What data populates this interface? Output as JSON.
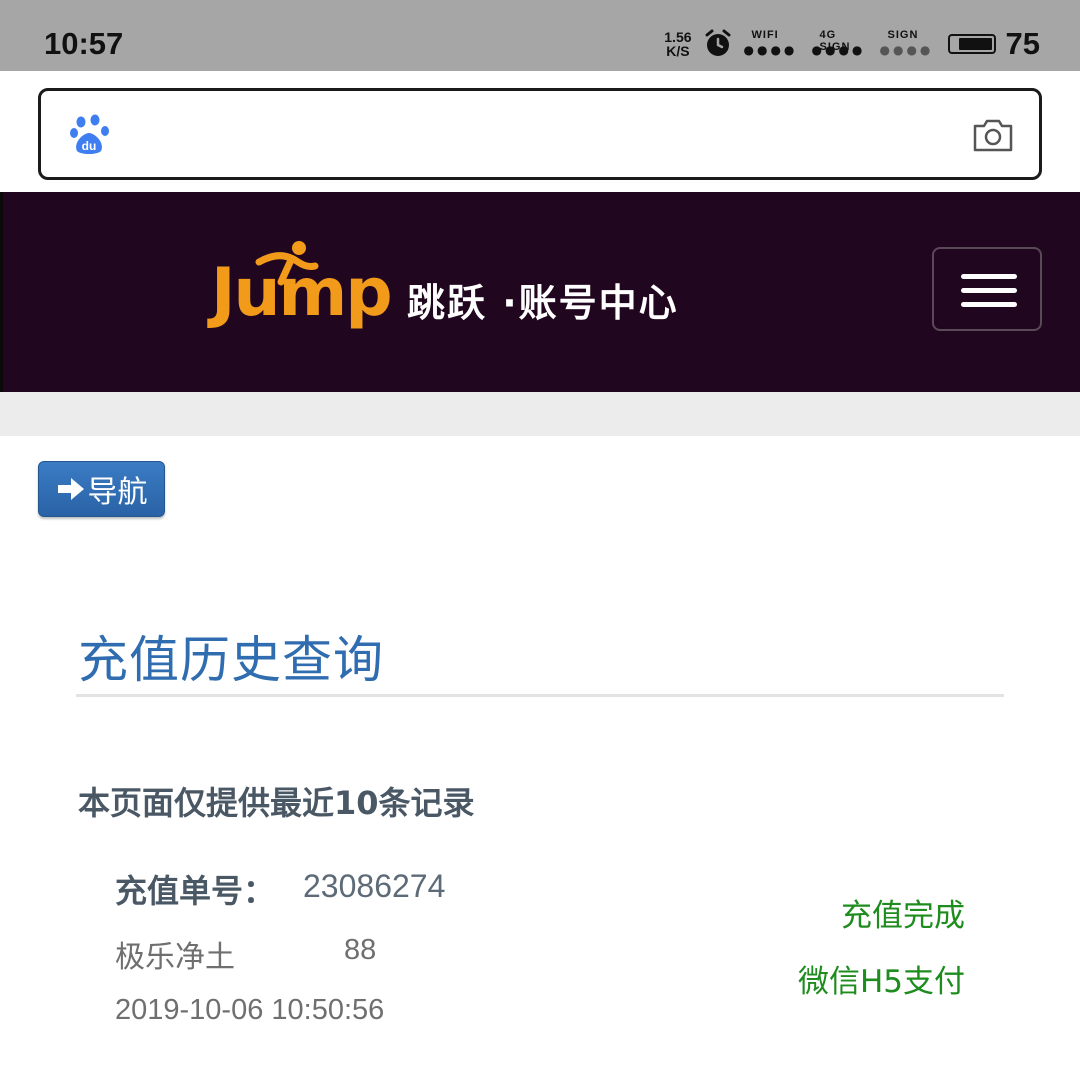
{
  "status_bar": {
    "time": "10:57",
    "speed_top": "1.56",
    "speed_bottom": "K/S",
    "wifi_label": "WIFI",
    "sig1_label": "SIGN",
    "sig1_badge": "4G",
    "sig2_label": "SIGN",
    "battery_level": "75"
  },
  "search_bar": {
    "engine": "du"
  },
  "header": {
    "logo_word": "Jump",
    "logo_text": "跳跃 ·账号中心"
  },
  "nav_button": {
    "label": "导航"
  },
  "page": {
    "title": "充值历史查询",
    "notice": "本页面仅提供最近10条记录"
  },
  "records": [
    {
      "order_label": "充值单号：",
      "order_number": "23086274",
      "server": "极乐净土",
      "amount": "88",
      "timestamp": "2019-10-06 10:50:56",
      "status": "充值完成",
      "pay_method": "微信H5支付"
    }
  ],
  "colors": {
    "header_bg": "#21061f",
    "logo_orange": "#f29a1a",
    "title_blue": "#2f6db0",
    "status_green": "#1e8c1e",
    "nav_button_blue": "#2f6db0"
  }
}
